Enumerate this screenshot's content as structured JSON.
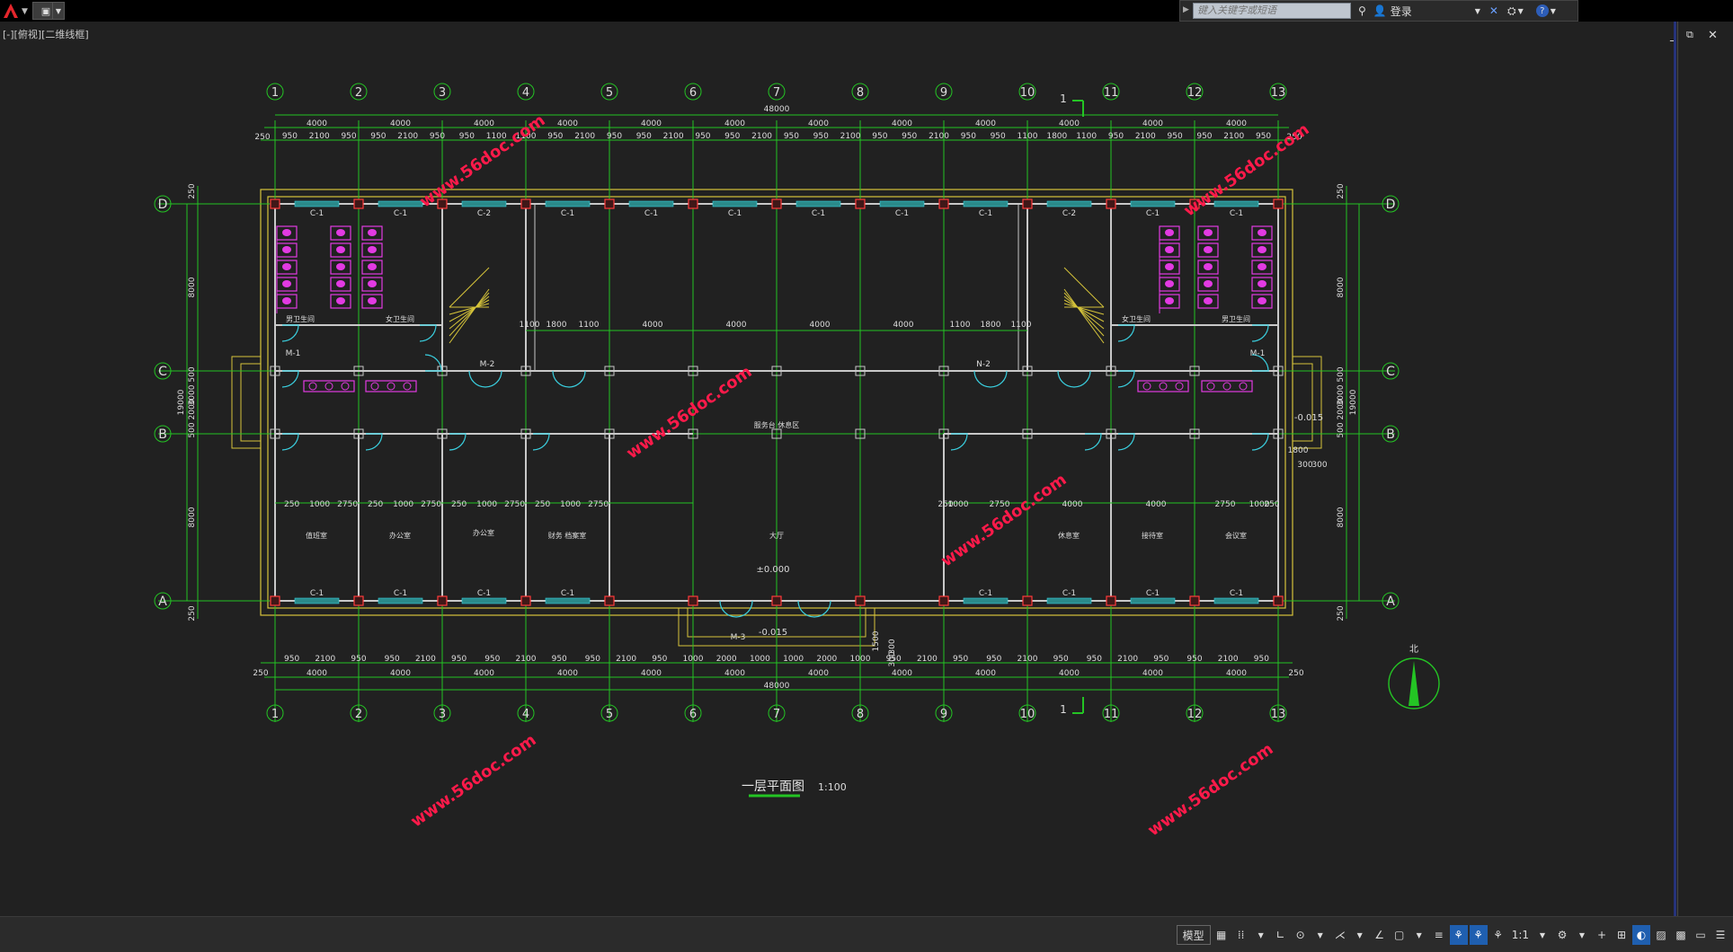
{
  "titlebar": {
    "search_placeholder": "键入关键字或短语",
    "signin_label": "登录"
  },
  "viewport": {
    "label": "[-][俯视][二维线框]"
  },
  "drawing": {
    "title": "一层平面图",
    "scale": "1:100",
    "north_label": "北",
    "overall_dim": "48000",
    "grid_top": [
      "1",
      "2",
      "3",
      "4",
      "5",
      "6",
      "7",
      "8",
      "9",
      "10",
      "11",
      "12",
      "13"
    ],
    "grid_rows": [
      "D",
      "C",
      "B",
      "A"
    ],
    "bay_dims": [
      "4000",
      "4000",
      "4000",
      "4000",
      "4000",
      "4000",
      "4000",
      "4000",
      "4000",
      "4000",
      "4000",
      "4000"
    ],
    "edge_dim": "250",
    "top_sub": [
      "950",
      "2100",
      "950",
      "950",
      "2100",
      "950",
      "950",
      "1100",
      "1100",
      "950",
      "2100",
      "950",
      "950",
      "2100",
      "950",
      "950",
      "2100",
      "950",
      "950",
      "2100",
      "950",
      "950",
      "2100",
      "950",
      "950",
      "1100",
      "1800",
      "1100",
      "950",
      "2100",
      "950",
      "950",
      "2100",
      "950"
    ],
    "bottom_sub": [
      "950",
      "2100",
      "950",
      "950",
      "2100",
      "950",
      "950",
      "2100",
      "950",
      "950",
      "2100",
      "950",
      "1000",
      "2000",
      "1000",
      "1000",
      "2000",
      "1000",
      "950",
      "2100",
      "950",
      "950",
      "2100",
      "950",
      "950",
      "2100",
      "950",
      "950",
      "2100",
      "950"
    ],
    "side_dims_left": [
      "250",
      "8000",
      "500",
      "3000",
      "2000",
      "500",
      "8000",
      "250"
    ],
    "side_total": "19000",
    "side_dims_right": [
      "250",
      "8000",
      "500",
      "3000",
      "2000",
      "500",
      "8000",
      "250"
    ],
    "side_extra": [
      "1800",
      "300",
      "300"
    ],
    "window_labels": [
      "C-1",
      "C-1",
      "C-2",
      "C-1",
      "C-1",
      "C-1",
      "C-1",
      "C-1",
      "C-1",
      "C-2",
      "C-1",
      "C-1"
    ],
    "window_labels_bottom": [
      "C-1",
      "C-1",
      "C-1",
      "C-1",
      "C-1",
      "C-1",
      "C-1",
      "C-1"
    ],
    "door_labels": [
      "M-1",
      "M-2",
      "M-3",
      "N-2",
      "M-1"
    ],
    "corridor_dims": [
      "1100",
      "1800",
      "1100",
      "4000",
      "4000",
      "4000",
      "4000",
      "1100",
      "1800",
      "1100"
    ],
    "room_dims_left": [
      "250",
      "1000",
      "2750",
      "250",
      "1000",
      "2750",
      "250",
      "1000",
      "2750",
      "250",
      "1000",
      "2750"
    ],
    "room_dims_right": [
      "250",
      "1000",
      "2750",
      "4000",
      "4000",
      "2750",
      "1000",
      "250"
    ],
    "rooms": [
      "值班室",
      "办公室",
      "办公室",
      "财务 档案室",
      "大厅",
      "男卫生间",
      "女卫生间",
      "男卫生间",
      "女卫生间",
      "服务台 休息区",
      "接待室",
      "会议室",
      "休息室"
    ],
    "levels": [
      "±0.000",
      "-0.015",
      "-0.015"
    ],
    "entrance_dims": [
      "1500",
      "300",
      "300"
    ],
    "section_mark": "1",
    "watermark": "www.56doc.com"
  },
  "statusbar": {
    "model_label": "模型",
    "scale_label": "1:1"
  },
  "colors": {
    "grid": "#24c424",
    "wall": "#c8c8c8",
    "outer": "#d6c43a",
    "fixture": "#e23ae2",
    "door": "#3ad0e0",
    "column": "#ff3a3a",
    "watermark": "#ff1a4a"
  }
}
